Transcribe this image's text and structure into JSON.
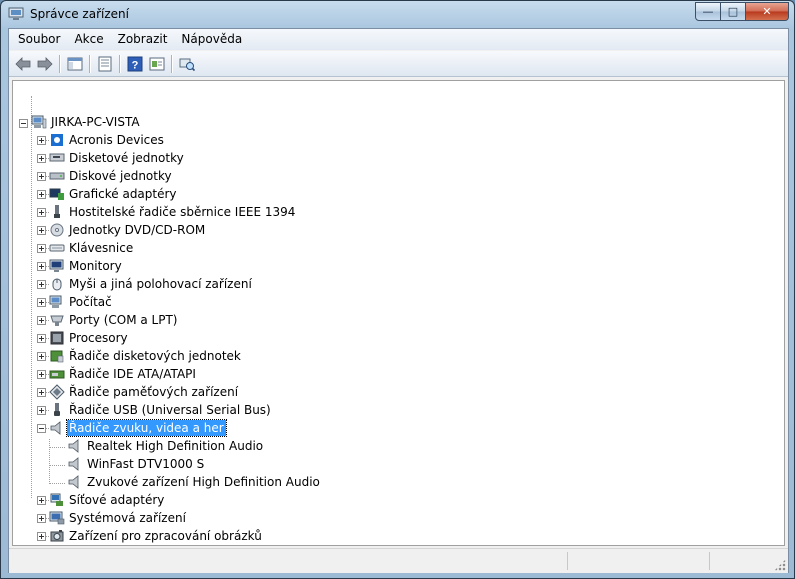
{
  "window": {
    "title": "Správce zařízení",
    "caption": {
      "minimize": "—",
      "maximize": "□",
      "close": "✕"
    }
  },
  "menu": [
    {
      "label": "Soubor"
    },
    {
      "label": "Akce"
    },
    {
      "label": "Zobrazit"
    },
    {
      "label": "Nápověda"
    }
  ],
  "toolbar": {
    "buttons": [
      "back-arrow-icon",
      "forward-arrow-icon",
      "show-hide-tree-icon",
      "properties-icon",
      "help-icon",
      "update-driver-icon",
      "scan-hardware-icon"
    ]
  },
  "tree": {
    "root": {
      "label": "JIRKA-PC-VISTA",
      "icon": "computer-icon"
    },
    "categories": [
      {
        "label": "Acronis Devices",
        "icon": "acronis-device-icon"
      },
      {
        "label": "Disketové jednotky",
        "icon": "floppy-drive-icon"
      },
      {
        "label": "Diskové jednotky",
        "icon": "hard-disk-icon"
      },
      {
        "label": "Grafické adaptéry",
        "icon": "display-adapter-icon"
      },
      {
        "label": "Hostitelské řadiče sběrnice IEEE 1394",
        "icon": "ieee1394-icon"
      },
      {
        "label": "Jednotky DVD/CD-ROM",
        "icon": "dvd-drive-icon"
      },
      {
        "label": "Klávesnice",
        "icon": "keyboard-icon"
      },
      {
        "label": "Monitory",
        "icon": "monitor-icon"
      },
      {
        "label": "Myši a jiná polohovací zařízení",
        "icon": "mouse-icon"
      },
      {
        "label": "Počítač",
        "icon": "computer-small-icon"
      },
      {
        "label": "Porty (COM a LPT)",
        "icon": "port-icon"
      },
      {
        "label": "Procesory",
        "icon": "processor-icon"
      },
      {
        "label": "Řadiče disketových jednotek",
        "icon": "floppy-controller-icon"
      },
      {
        "label": "Řadiče IDE ATA/ATAPI",
        "icon": "ide-controller-icon"
      },
      {
        "label": "Řadiče paměťových zařízení",
        "icon": "storage-controller-icon"
      },
      {
        "label": "Řadiče USB (Universal Serial Bus)",
        "icon": "usb-icon"
      },
      {
        "label": "Řadiče zvuku, videa a her",
        "icon": "speaker-icon",
        "expanded": true,
        "selected": true,
        "children": [
          {
            "label": "Realtek High Definition Audio",
            "icon": "speaker-icon"
          },
          {
            "label": "WinFast DTV1000 S",
            "icon": "speaker-icon"
          },
          {
            "label": "Zvukové zařízení High Definition Audio",
            "icon": "speaker-icon"
          }
        ]
      },
      {
        "label": "Síťové adaptéry",
        "icon": "network-adapter-icon"
      },
      {
        "label": "Systémová zařízení",
        "icon": "system-device-icon"
      },
      {
        "label": "Zařízení pro zpracování obrázků",
        "icon": "imaging-device-icon"
      }
    ]
  },
  "colors": {
    "selection": "#3399ff",
    "titlebar": "#a9c6df"
  }
}
